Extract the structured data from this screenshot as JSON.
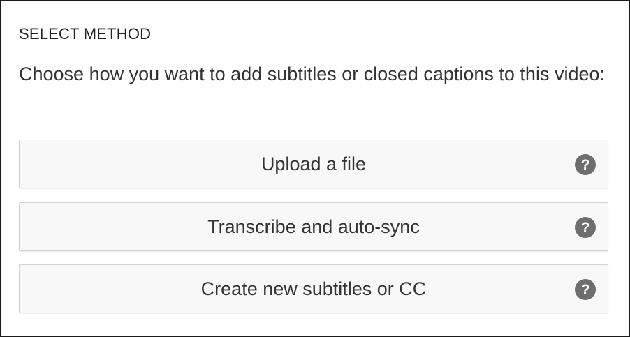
{
  "section": {
    "heading": "SELECT METHOD",
    "description": "Choose how you want to add subtitles or closed captions to this video:"
  },
  "options": [
    {
      "label": "Upload a file",
      "icon": "help-icon"
    },
    {
      "label": "Transcribe and auto-sync",
      "icon": "help-icon"
    },
    {
      "label": "Create new subtitles or CC",
      "icon": "help-icon"
    }
  ],
  "help_icon_glyph": "?",
  "colors": {
    "button_background": "#f8f8f8",
    "button_border": "#d3d3d3",
    "help_icon": "#6e6e6e",
    "text": "#333333"
  }
}
